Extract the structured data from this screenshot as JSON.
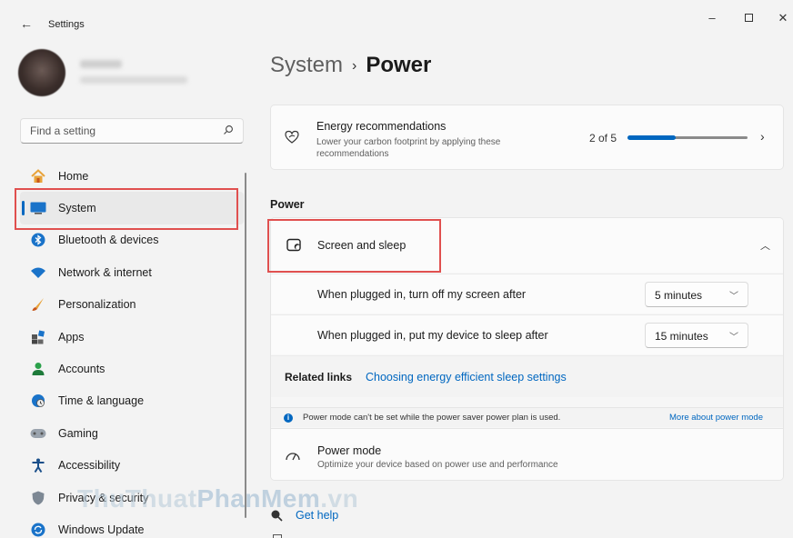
{
  "window": {
    "title": "Settings",
    "back_icon": "arrow-left-icon",
    "controls": {
      "minimize": "–",
      "close": "✕"
    }
  },
  "search": {
    "placeholder": "Find a setting"
  },
  "nav": {
    "items": [
      {
        "label": "Home",
        "icon": "home-icon"
      },
      {
        "label": "System",
        "icon": "system-icon",
        "active": true
      },
      {
        "label": "Bluetooth & devices",
        "icon": "bluetooth-icon"
      },
      {
        "label": "Network & internet",
        "icon": "wifi-icon"
      },
      {
        "label": "Personalization",
        "icon": "brush-icon"
      },
      {
        "label": "Apps",
        "icon": "apps-icon"
      },
      {
        "label": "Accounts",
        "icon": "account-icon"
      },
      {
        "label": "Time & language",
        "icon": "globe-clock-icon"
      },
      {
        "label": "Gaming",
        "icon": "gamepad-icon"
      },
      {
        "label": "Accessibility",
        "icon": "accessibility-icon"
      },
      {
        "label": "Privacy & security",
        "icon": "shield-icon"
      },
      {
        "label": "Windows Update",
        "icon": "update-icon"
      }
    ]
  },
  "breadcrumb": {
    "parent": "System",
    "separator": "›",
    "current": "Power"
  },
  "energy": {
    "title": "Energy recommendations",
    "subtitle": "Lower your carbon footprint by applying these recommendations",
    "progress_text": "2 of 5",
    "progress_fraction": 0.4
  },
  "section_label": "Power",
  "screen_sleep": {
    "title": "Screen and sleep",
    "rows": [
      {
        "label": "When plugged in, turn off my screen after",
        "value": "5 minutes"
      },
      {
        "label": "When plugged in, put my device to sleep after",
        "value": "15 minutes"
      }
    ]
  },
  "related": {
    "label": "Related links",
    "link": "Choosing energy efficient sleep settings"
  },
  "info_bar": {
    "text": "Power mode can't be set while the power saver power plan is used.",
    "link": "More about power mode"
  },
  "power_mode": {
    "title": "Power mode",
    "subtitle": "Optimize your device based on power use and performance"
  },
  "help": {
    "label": "Get help"
  },
  "watermark": {
    "part1": "ThuThuat",
    "part2": "PhanMem",
    "part3": ".vn"
  },
  "colors": {
    "accent": "#0067c0",
    "highlight_box": "#e0504f"
  }
}
